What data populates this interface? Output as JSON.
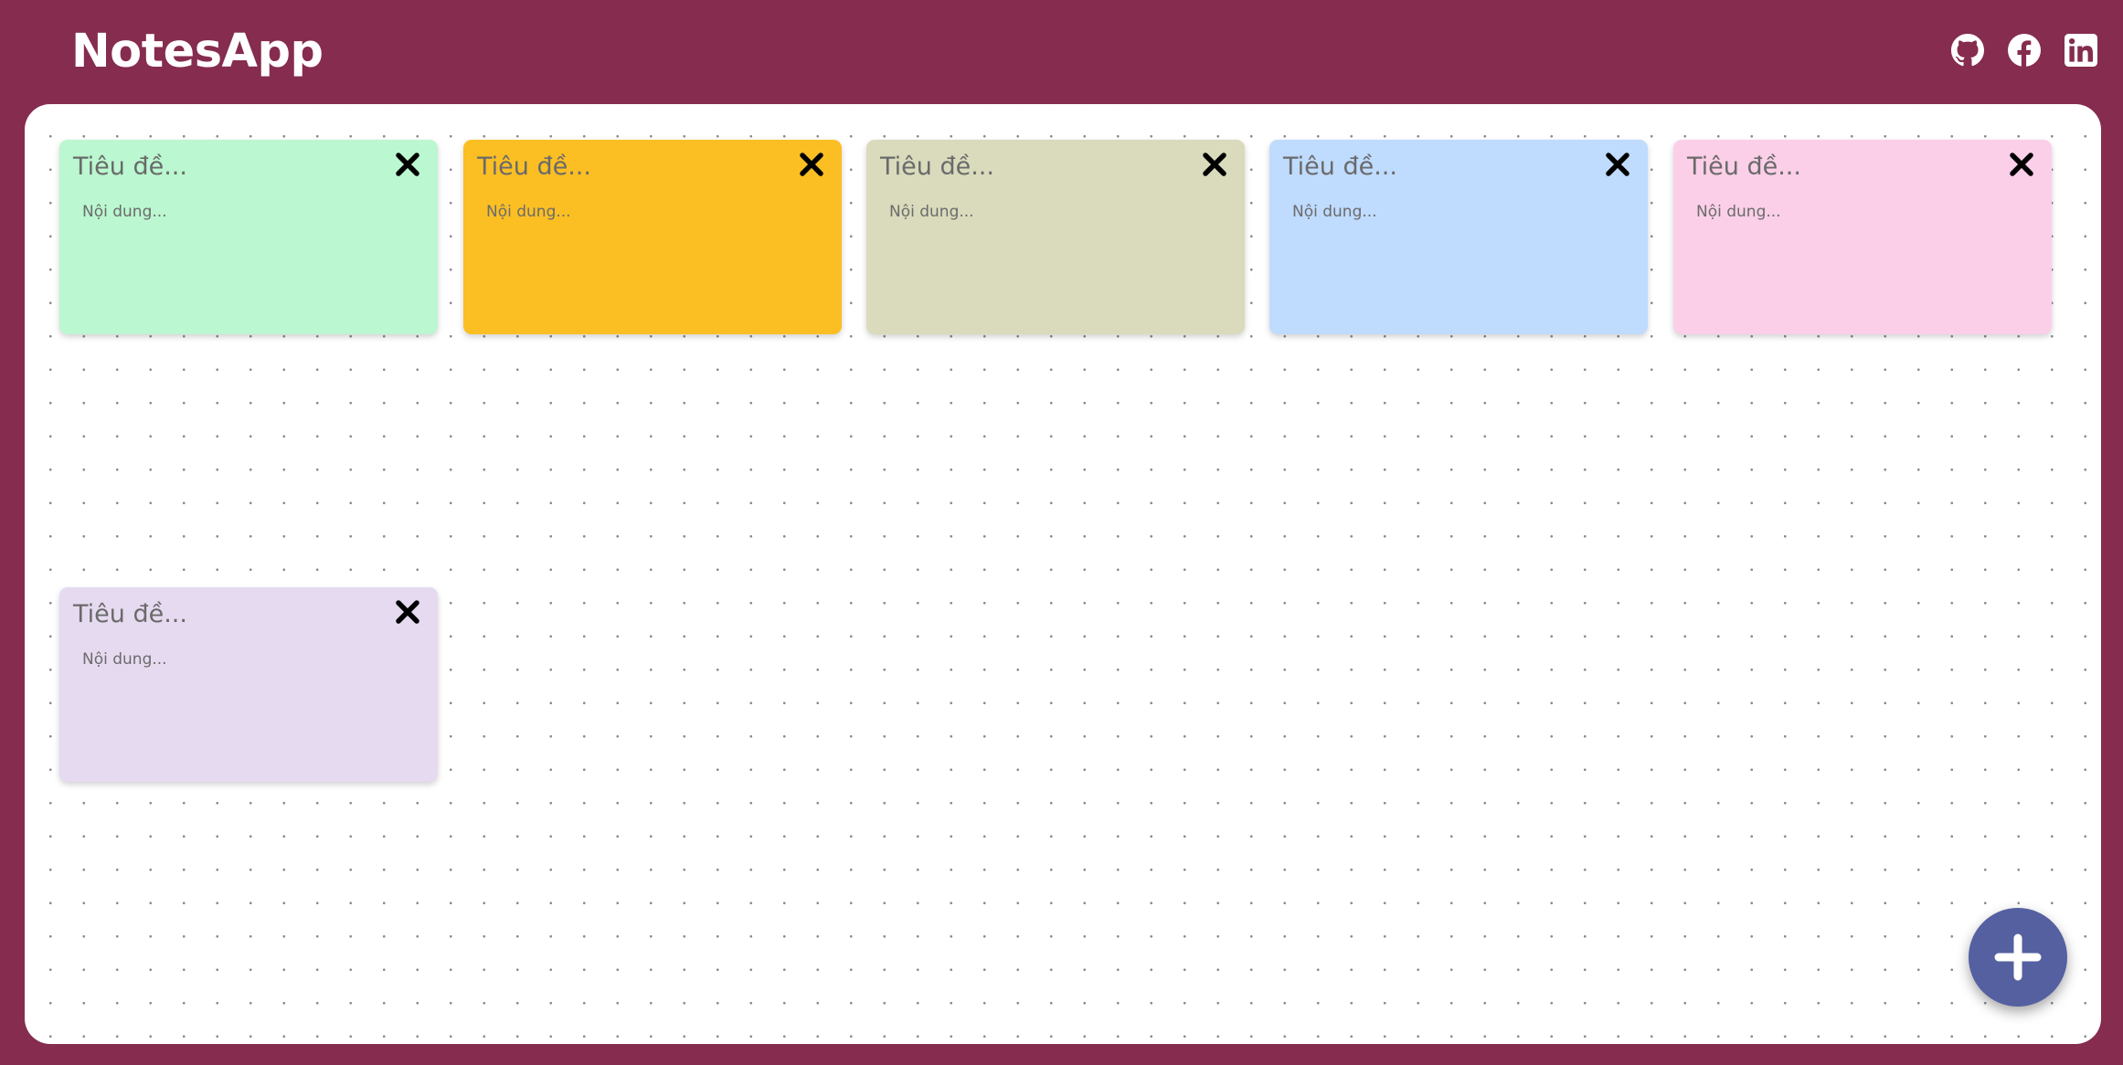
{
  "app": {
    "title": "NotesApp"
  },
  "header": {
    "social": [
      {
        "icon": "github-icon"
      },
      {
        "icon": "facebook-icon"
      },
      {
        "icon": "linkedin-icon"
      }
    ]
  },
  "notes": [
    {
      "title": "Tiêu đề...",
      "body": "Nội dung...",
      "color": "#bbf7d0"
    },
    {
      "title": "Tiêu đề...",
      "body": "Nội dung...",
      "color": "#fbbf24"
    },
    {
      "title": "Tiêu đề...",
      "body": "Nội dung...",
      "color": "#d9dbbc"
    },
    {
      "title": "Tiêu đề...",
      "body": "Nội dung...",
      "color": "#bfdbfe"
    },
    {
      "title": "Tiêu đề...",
      "body": "Nội dung...",
      "color": "#fbcfe8"
    },
    {
      "title": "Tiêu đề...",
      "body": "Nội dung...",
      "color": "#e6daf0"
    }
  ],
  "fab": {
    "icon": "plus-icon"
  },
  "colors": {
    "background": "#852c4f",
    "board": "#ffffff",
    "fab": "#5460a0"
  }
}
